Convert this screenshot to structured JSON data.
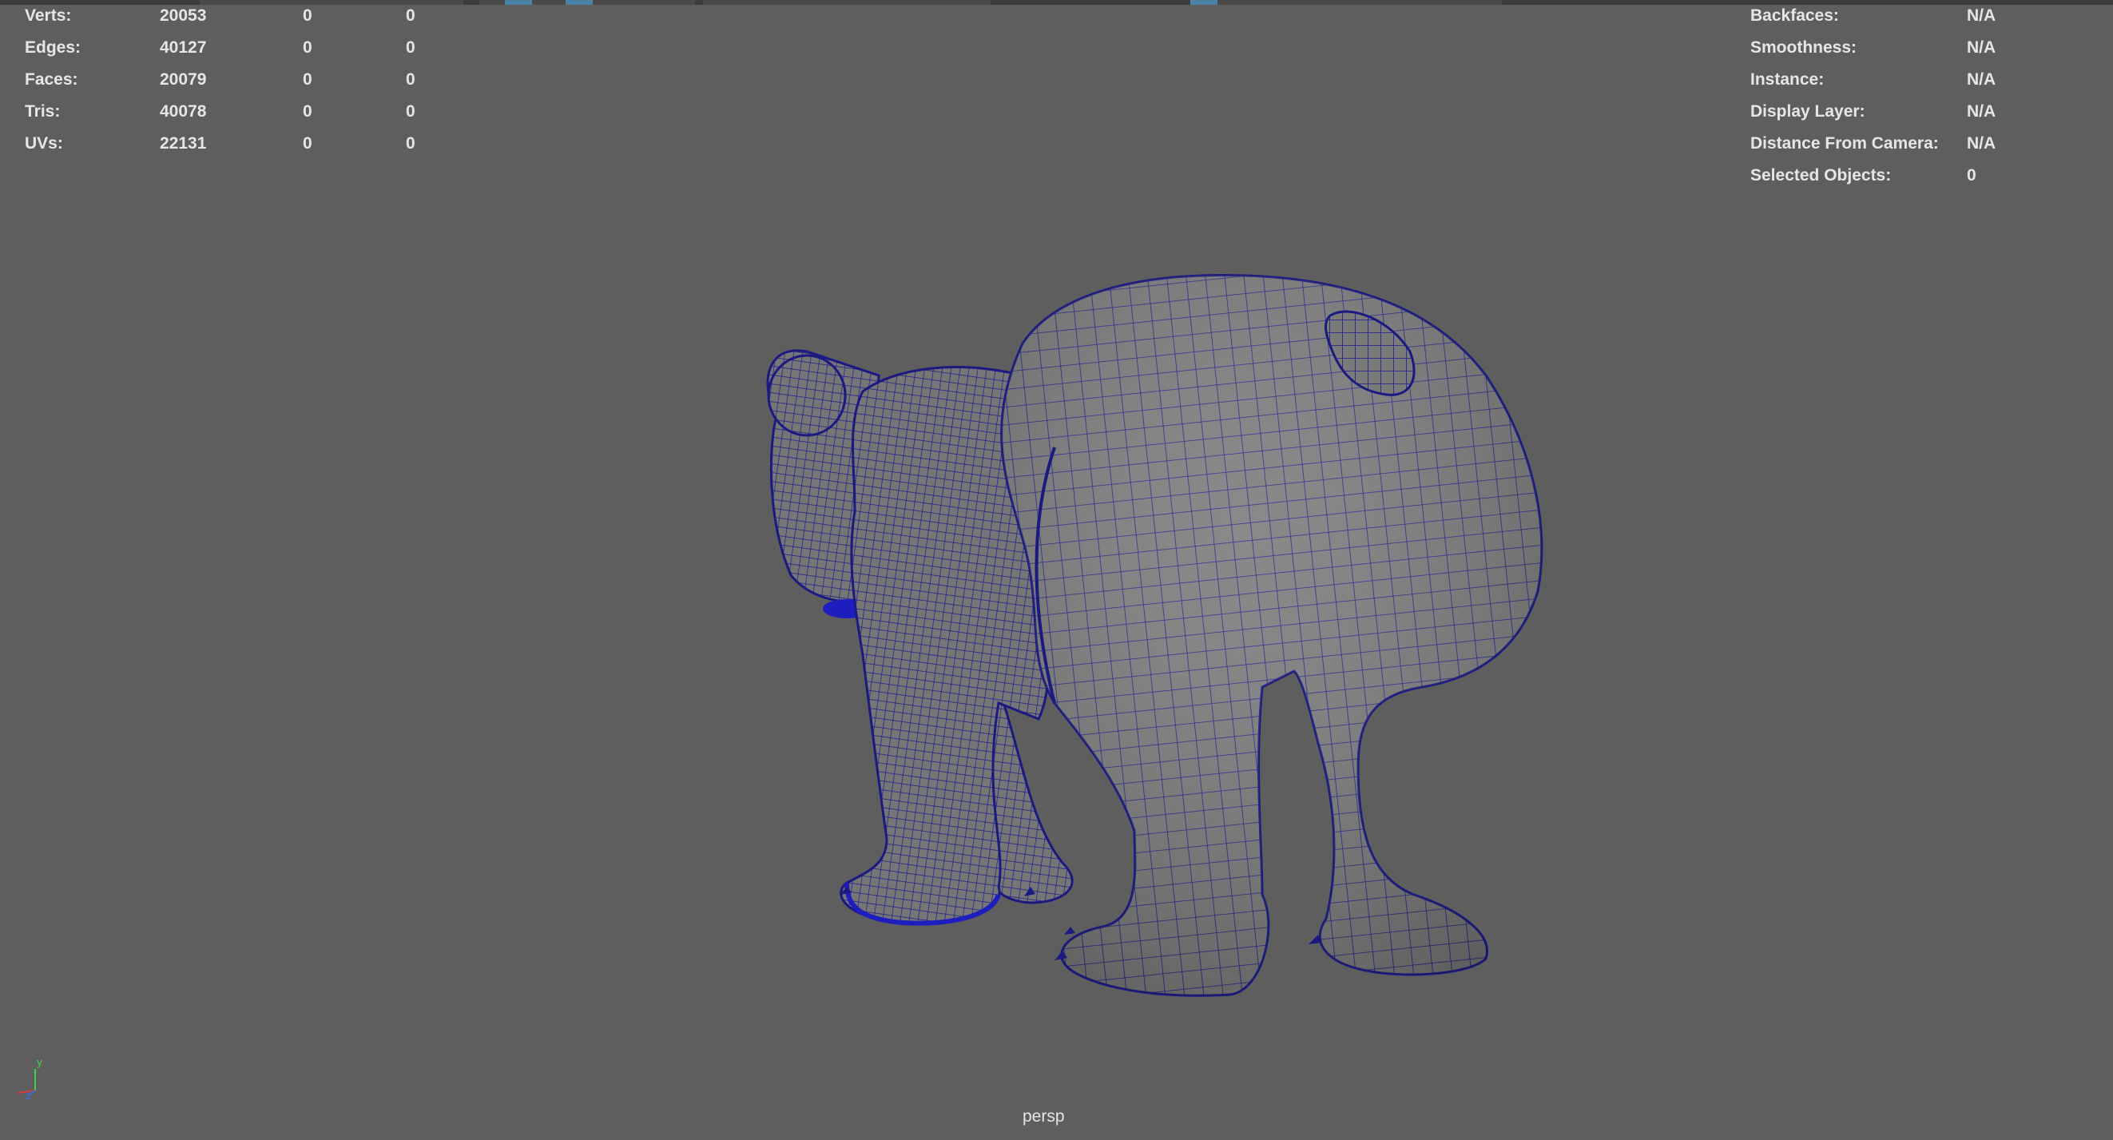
{
  "stats": {
    "verts": {
      "label": "Verts:",
      "total": "20053",
      "selected": "0",
      "sel_triangle": "0"
    },
    "edges": {
      "label": "Edges:",
      "total": "40127",
      "selected": "0",
      "sel_triangle": "0"
    },
    "faces": {
      "label": "Faces:",
      "total": "20079",
      "selected": "0",
      "sel_triangle": "0"
    },
    "tris": {
      "label": "Tris:",
      "total": "40078",
      "selected": "0",
      "sel_triangle": "0"
    },
    "uvs": {
      "label": "UVs:",
      "total": "22131",
      "selected": "0",
      "sel_triangle": "0"
    }
  },
  "object_info": {
    "backfaces": {
      "label": "Backfaces:",
      "value": "N/A"
    },
    "smoothness": {
      "label": "Smoothness:",
      "value": "N/A"
    },
    "instance": {
      "label": "Instance:",
      "value": "N/A"
    },
    "display_layer": {
      "label": "Display Layer:",
      "value": "N/A"
    },
    "distance": {
      "label": "Distance From Camera:",
      "value": "N/A"
    },
    "selected": {
      "label": "Selected Objects:",
      "value": "0"
    }
  },
  "viewport": {
    "camera": "persp",
    "background": "#5e5e5e",
    "wire_color": "#1c1c8c",
    "mesh_fill": "#7a7a7a"
  },
  "axis_gizmo": {
    "y_label": "y",
    "z_label": "z",
    "y_color": "#3fd23f",
    "z_color": "#3b6bd8",
    "x_color": "#d83b3b"
  }
}
